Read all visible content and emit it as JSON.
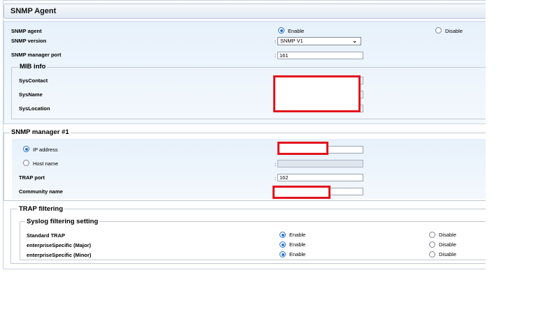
{
  "title": "SNMP Agent",
  "agent": {
    "agent_label": "SNMP agent",
    "enable_label": "Enable",
    "disable_label": "Disable",
    "agent_selected": "enable",
    "version_label": "SNMP version",
    "version_value": "SNMP V1",
    "manager_port_label": "SNMP manager port",
    "manager_port_value": "161",
    "colon": ":"
  },
  "mib": {
    "legend": "MIB info",
    "syscontact_label": "SysContact",
    "sysname_label": "SysName",
    "syslocation_label": "SysLocation"
  },
  "manager": {
    "legend": "SNMP manager #1",
    "ip_label": "IP address",
    "host_label": "Host name",
    "selected": "ip",
    "trap_port_label": "TRAP port",
    "trap_port_value": "162",
    "community_label": "Community name"
  },
  "trap": {
    "legend": "TRAP filtering",
    "syslog_legend": "Syslog filtering setting",
    "rows": [
      {
        "label": "Standard TRAP",
        "enable": "Enable",
        "disable": "Disable",
        "selected": "enable"
      },
      {
        "label": "enterpriseSpecific (Major)",
        "enable": "Enable",
        "disable": "Disable",
        "selected": "enable"
      },
      {
        "label": "enterpriseSpecific (Minor)",
        "enable": "Enable",
        "disable": "Disable",
        "selected": "enable"
      }
    ]
  },
  "colors": {
    "accent": "#2b73c8",
    "redact": "#e2131d",
    "panel_blue": "#e7f1fb"
  }
}
